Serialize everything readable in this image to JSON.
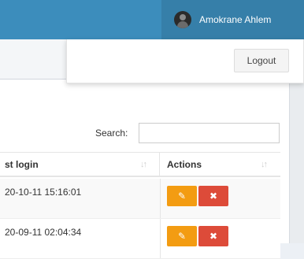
{
  "header": {
    "username": "Amokrane Ahlem",
    "avatar_icon": "user-avatar"
  },
  "user_menu": {
    "logout_label": "Logout"
  },
  "table_controls": {
    "search_label": "Search:",
    "search_value": ""
  },
  "table": {
    "columns": [
      {
        "label": "st login",
        "sort_icon": "↓↑"
      },
      {
        "label": "Actions",
        "sort_icon": "↓↑"
      }
    ],
    "rows": [
      {
        "last_login": "20-10-11 15:16:01",
        "edit_icon": "✎",
        "delete_icon": "✖"
      },
      {
        "last_login": "20-09-11 02:04:34",
        "edit_icon": "✎",
        "delete_icon": "✖"
      }
    ]
  },
  "colors": {
    "topbar": "#3c8dbc",
    "edit_button": "#f39c12",
    "delete_button": "#dd4b39"
  }
}
